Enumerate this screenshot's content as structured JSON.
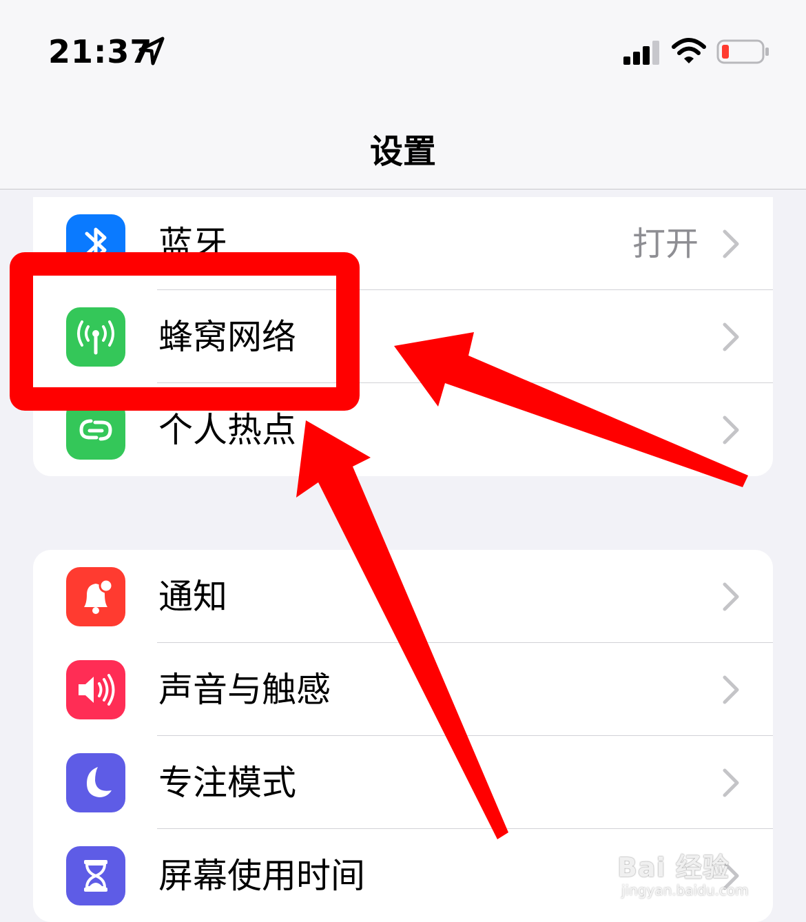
{
  "status_bar": {
    "time": "21:37",
    "icons": [
      "location-arrow-icon",
      "cellular-signal-icon",
      "wifi-icon",
      "battery-low-icon"
    ],
    "battery_color": "#ff3b30"
  },
  "nav": {
    "title": "设置"
  },
  "group1": {
    "items": [
      {
        "label": "蓝牙",
        "value": "打开",
        "icon": "bluetooth-icon",
        "color": "#0a7aff"
      },
      {
        "label": "蜂窝网络",
        "value": "",
        "icon": "cellular-antenna-icon",
        "color": "#34c759"
      },
      {
        "label": "个人热点",
        "value": "",
        "icon": "personal-hotspot-icon",
        "color": "#34c759"
      }
    ]
  },
  "group2": {
    "items": [
      {
        "label": "通知",
        "icon": "bell-icon",
        "color": "#ff3b30"
      },
      {
        "label": "声音与触感",
        "icon": "speaker-icon",
        "color": "#ff2d55"
      },
      {
        "label": "专注模式",
        "icon": "moon-icon",
        "color": "#5e5ce6"
      },
      {
        "label": "屏幕使用时间",
        "icon": "hourglass-icon",
        "color": "#5e5ce6"
      }
    ]
  },
  "annotation": {
    "color": "#ff0000",
    "highlighted_item": "蜂窝网络"
  },
  "watermark": {
    "main": "Bai 经验",
    "sub": "jingyan.baidu.com"
  }
}
